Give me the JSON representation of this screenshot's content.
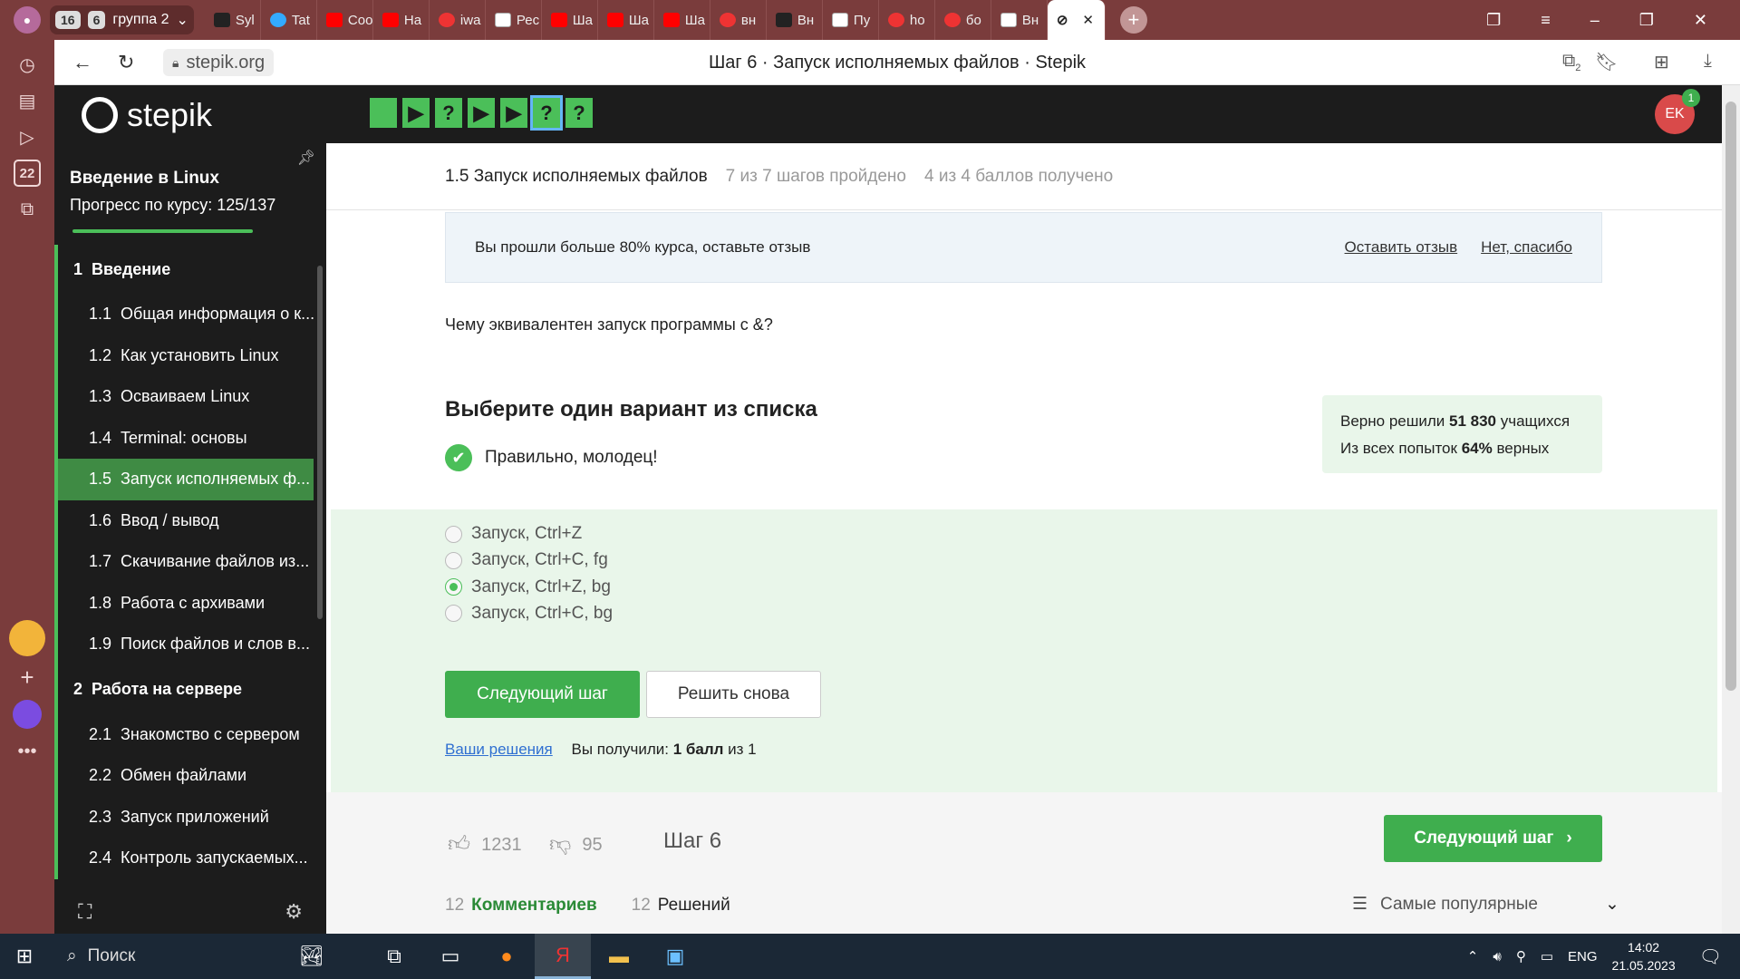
{
  "browser": {
    "tab_group_count": "16",
    "group_label": "6",
    "group_name": "группа 2",
    "tabs": [
      {
        "title": "Syl",
        "fav": "dk"
      },
      {
        "title": "Tat",
        "fav": "tat"
      },
      {
        "title": "Coo",
        "fav": "yt"
      },
      {
        "title": "На",
        "fav": "yt"
      },
      {
        "title": "iwa",
        "fav": "ya"
      },
      {
        "title": "Рес",
        "fav": "pg"
      },
      {
        "title": "Ша",
        "fav": "yt"
      },
      {
        "title": "Ша",
        "fav": "yt"
      },
      {
        "title": "Ша",
        "fav": "yt"
      },
      {
        "title": "вн",
        "fav": "ya"
      },
      {
        "title": "Вн",
        "fav": "dk"
      },
      {
        "title": "Пу",
        "fav": "pg"
      },
      {
        "title": "ho",
        "fav": "ya"
      },
      {
        "title": "бо",
        "fav": "ya"
      },
      {
        "title": "Вн",
        "fav": "pg"
      }
    ],
    "url": "stepik.org",
    "page_title": "Шаг 6 · Запуск исполняемых файлов · Stepik",
    "rail_date": "22",
    "sync_badge": "2"
  },
  "header": {
    "logo_text": "stepik",
    "steps": [
      "",
      "▶",
      "?",
      "▶",
      "▶",
      "?",
      "?"
    ],
    "current_step_index": 5,
    "avatar_initials": "EK",
    "notification_count": "1"
  },
  "sidebar": {
    "course_title": "Введение в Linux",
    "progress_label": "Прогресс по курсу:",
    "progress_value": "125/137",
    "progress_fraction": 0.912,
    "items": [
      {
        "num": "1",
        "label": "Введение",
        "section": true
      },
      {
        "num": "1.1",
        "label": "Общая информация о к..."
      },
      {
        "num": "1.2",
        "label": "Как установить Linux"
      },
      {
        "num": "1.3",
        "label": "Осваиваем Linux"
      },
      {
        "num": "1.4",
        "label": "Terminal: основы"
      },
      {
        "num": "1.5",
        "label": "Запуск исполняемых ф...",
        "active": true
      },
      {
        "num": "1.6",
        "label": "Ввод / вывод"
      },
      {
        "num": "1.7",
        "label": "Скачивание файлов из..."
      },
      {
        "num": "1.8",
        "label": "Работа с архивами"
      },
      {
        "num": "1.9",
        "label": "Поиск файлов и слов в..."
      },
      {
        "num": "2",
        "label": "Работа на сервере",
        "section": true
      },
      {
        "num": "2.1",
        "label": "Знакомство с сервером"
      },
      {
        "num": "2.2",
        "label": "Обмен файлами"
      },
      {
        "num": "2.3",
        "label": "Запуск приложений"
      },
      {
        "num": "2.4",
        "label": "Контроль запускаемых..."
      }
    ]
  },
  "lesson": {
    "title": "1.5 Запуск исполняемых файлов",
    "steps_done": "7 из 7 шагов пройдено",
    "points": "4 из 4 баллов  получено"
  },
  "review": {
    "text": "Вы прошли больше 80% курса, оставьте отзыв",
    "leave_label": "Оставить отзыв",
    "decline_label": "Нет, спасибо"
  },
  "quiz": {
    "question": "Чему эквивалентен запуск программы с &?",
    "instruction": "Выберите один вариант из списка",
    "correct_msg": "Правильно, молодец!",
    "stats_solved_prefix": "Верно решили ",
    "stats_solved_value": "51 830",
    "stats_solved_suffix": " учащихся",
    "stats_attempts_prefix": "Из всех попыток ",
    "stats_attempts_value": "64%",
    "stats_attempts_suffix": " верных",
    "options": [
      {
        "label": "Запуск, Ctrl+Z",
        "selected": false
      },
      {
        "label": "Запуск, Ctrl+C, fg",
        "selected": false
      },
      {
        "label": "Запуск, Ctrl+Z, bg",
        "selected": true
      },
      {
        "label": "Запуск, Ctrl+C, bg",
        "selected": false
      }
    ],
    "next_label": "Следующий шаг",
    "retry_label": "Решить снова",
    "solutions_link": "Ваши решения",
    "score_prefix": "Вы получили: ",
    "score_value": "1 балл",
    "score_suffix": " из 1"
  },
  "footer": {
    "likes": "1231",
    "dislikes": "95",
    "step_label": "Шаг 6",
    "next_label": "Следующий шаг",
    "comments_count": "12",
    "comments_label": "Комментариев",
    "solutions_count": "12",
    "solutions_label": "Решений",
    "sort_label": "Самые популярные"
  },
  "taskbar": {
    "search_label": "Поиск",
    "lang": "ENG",
    "time": "14:02",
    "date": "21.05.2023"
  },
  "colors": {
    "brand_green": "#3fae4e",
    "tab_bar": "#7a3c3c",
    "header_dark": "#1c1c1c",
    "light_green": "#e9f6ea"
  }
}
